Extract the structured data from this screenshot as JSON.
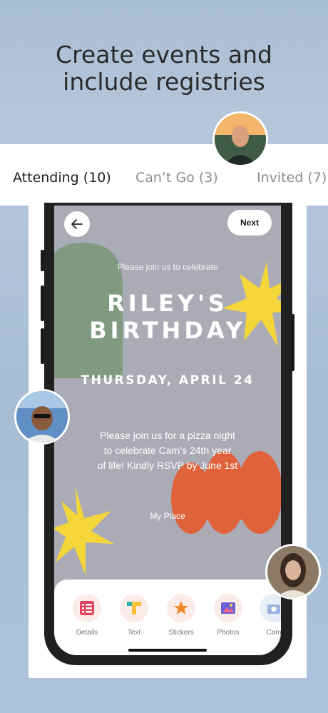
{
  "headline": {
    "line1": "Create events and",
    "line2": "include registries"
  },
  "tabs": [
    {
      "label": "Attending",
      "count": "(10)"
    },
    {
      "label": "Can’t Go",
      "count": "(3)"
    },
    {
      "label": "Invited",
      "count": "(7)"
    }
  ],
  "nav": {
    "next_label": "Next"
  },
  "invitation": {
    "intro": "Please join us to celebrate",
    "title_line1": "RILEY'S",
    "title_line2": "BIRTHDAY",
    "date": "THURSDAY, APRIL 24",
    "body_line1": "Please join us for a pizza night",
    "body_line2": "to celebrate Cam’s 24th year",
    "body_line3": "of life!  Kindly RSVP by June 1st",
    "place": "My Place"
  },
  "toolbar": [
    {
      "label": "Details",
      "icon": "details-icon"
    },
    {
      "label": "Text",
      "icon": "text-icon"
    },
    {
      "label": "Stickers",
      "icon": "star-sticker-icon"
    },
    {
      "label": "Photos",
      "icon": "photos-icon"
    },
    {
      "label": "Cam",
      "icon": "camera-icon"
    }
  ],
  "colors": {
    "background": "#a9bdd3",
    "invite_bg": "#ababb6",
    "green_arch": "#7f9a80",
    "yellow_star": "#f5d63a",
    "orange_blob": "#e0623a"
  }
}
